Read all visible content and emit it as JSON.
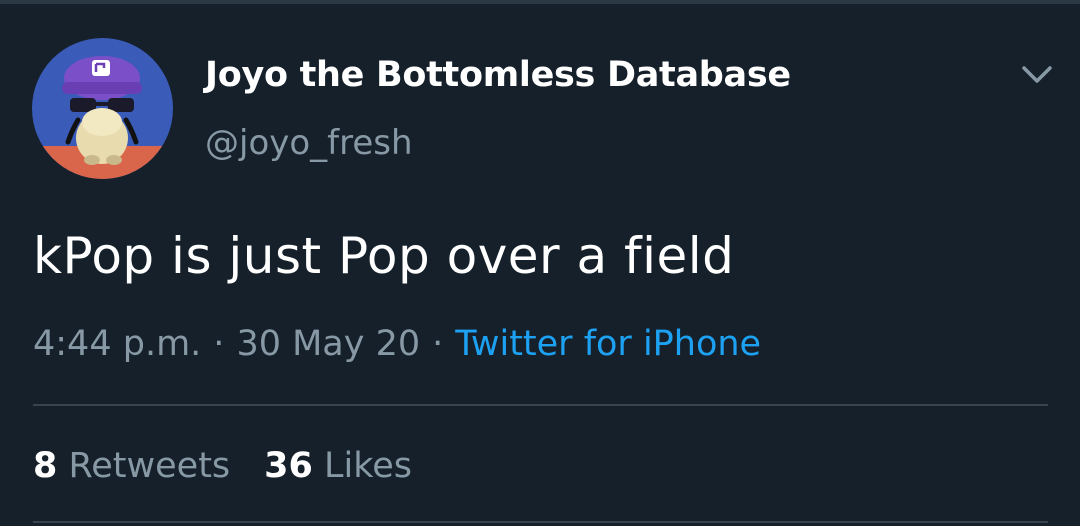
{
  "tweet": {
    "author": {
      "display_name": "Joyo the Bottomless Database",
      "handle": "@joyo_fresh",
      "avatar_icon": "waluigi-plush-avatar-icon"
    },
    "text": "kPop is just Pop over a field",
    "time": "4:44 p.m.",
    "date": "30 May 20",
    "source": "Twitter for iPhone",
    "separator": "·",
    "stats": {
      "retweets_count": "8",
      "retweets_label": "Retweets",
      "likes_count": "36",
      "likes_label": "Likes"
    },
    "menu_icon": "chevron-down-icon"
  },
  "colors": {
    "background": "#15202b",
    "primary_text": "#ffffff",
    "secondary_text": "#8899a6",
    "link": "#1da1f2",
    "divider": "#38444d"
  }
}
